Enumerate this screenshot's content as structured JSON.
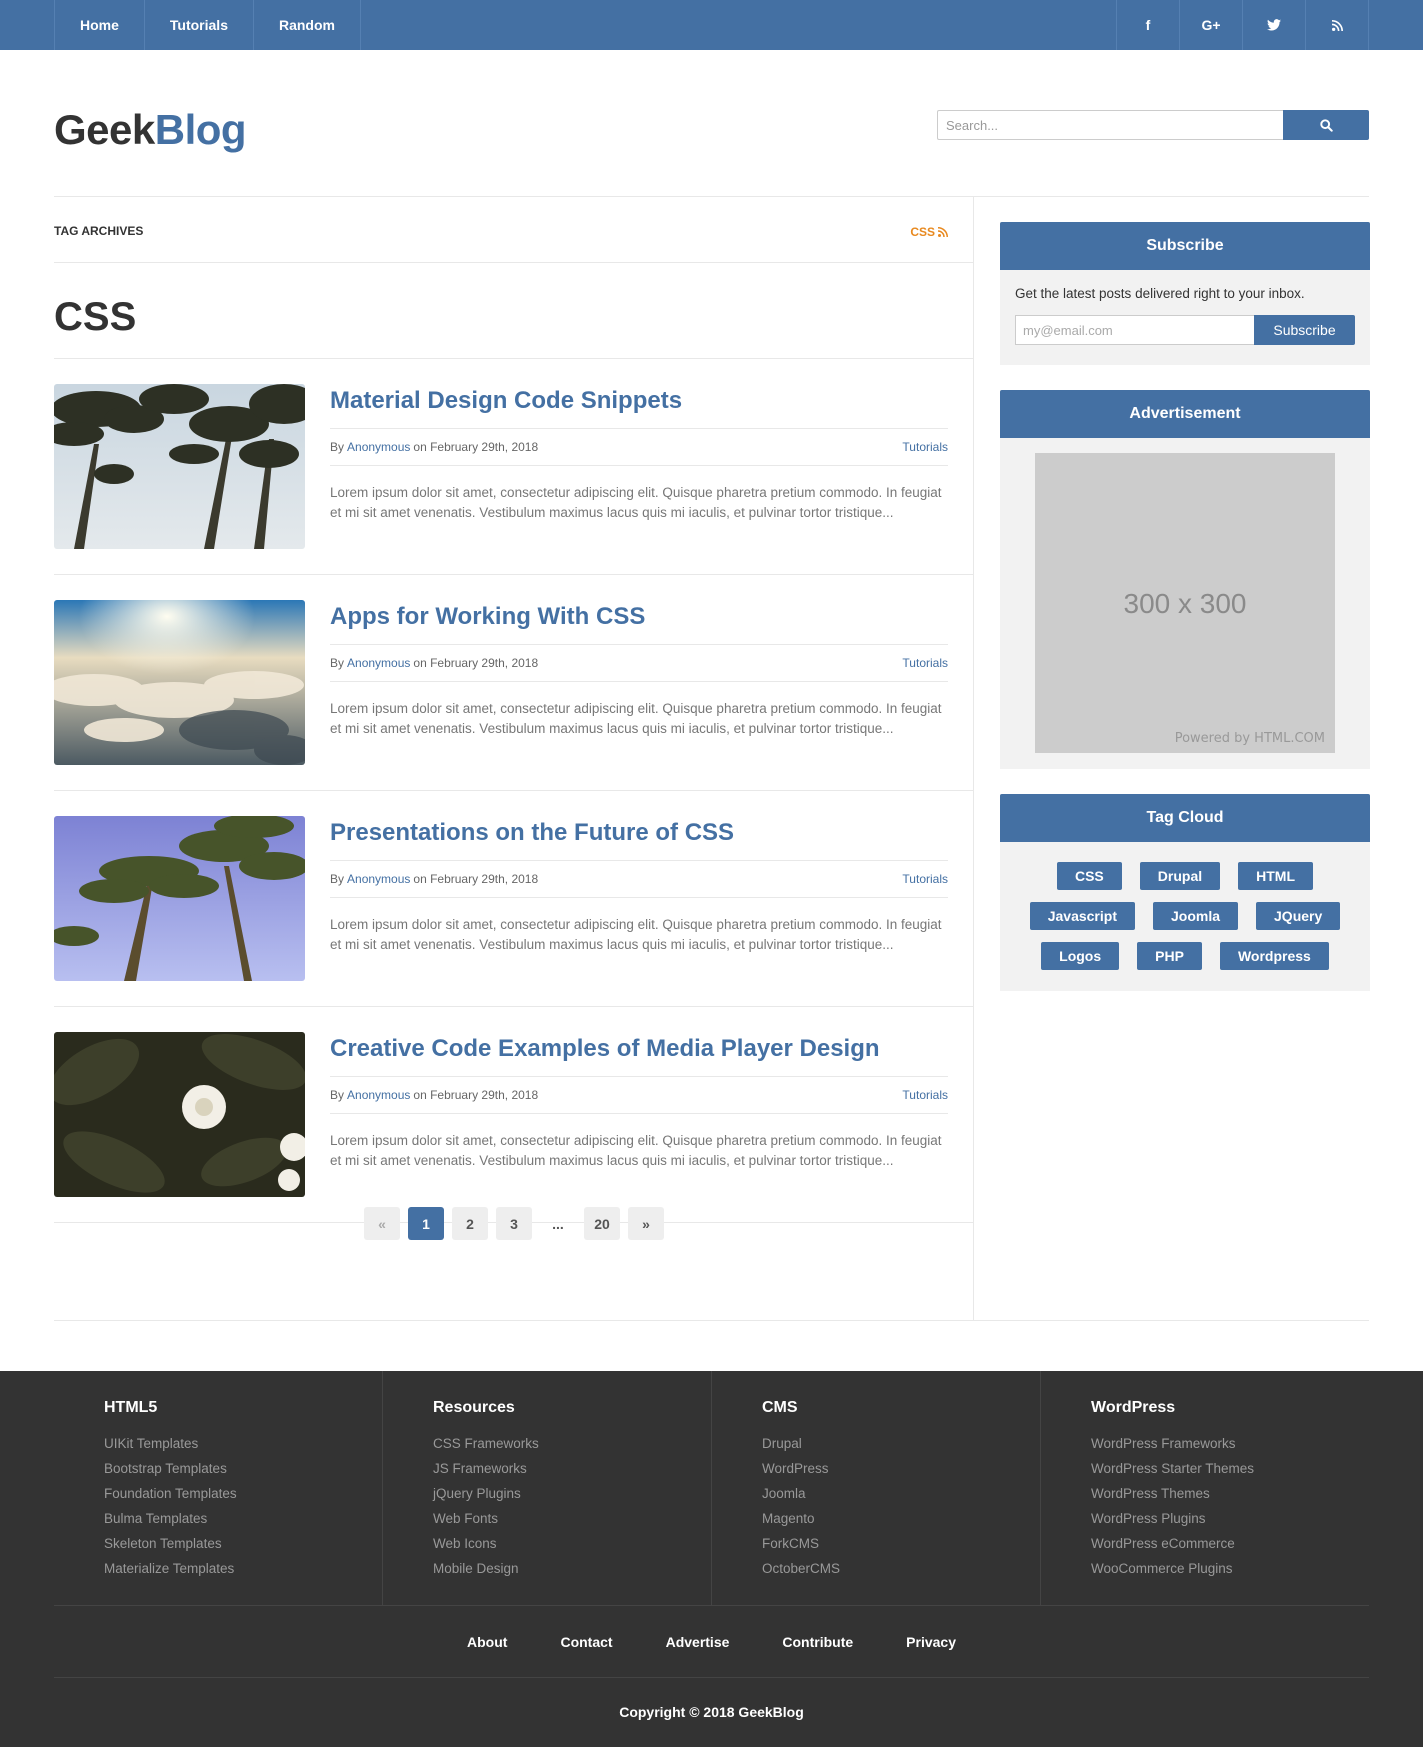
{
  "nav": {
    "items": [
      {
        "label": "Home"
      },
      {
        "label": "Tutorials"
      },
      {
        "label": "Random"
      }
    ],
    "social": [
      {
        "label": "f",
        "icon": "facebook-icon"
      },
      {
        "label": "G+",
        "icon": "google-plus-icon"
      },
      {
        "label": "",
        "icon": "twitter-icon"
      },
      {
        "label": "",
        "icon": "rss-icon"
      }
    ]
  },
  "header": {
    "logo_part1": "Geek",
    "logo_part2": "Blog",
    "search_placeholder": "Search..."
  },
  "archive": {
    "label": "Tag Archives",
    "feed_label": "CSS",
    "tag_title": "CSS"
  },
  "posts": [
    {
      "title": "Material Design Code Snippets",
      "by": "By",
      "author": "Anonymous",
      "date": "on February 29th, 2018",
      "category": "Tutorials",
      "excerpt": "Lorem ipsum dolor sit amet, consectetur adipiscing elit. Quisque pharetra pretium commodo. In feugiat et mi sit amet venenatis. Vestibulum maximus lacus quis mi iaculis, et pulvinar tortor tristique..."
    },
    {
      "title": "Apps for Working With CSS",
      "by": "By",
      "author": "Anonymous",
      "date": "on February 29th, 2018",
      "category": "Tutorials",
      "excerpt": "Lorem ipsum dolor sit amet, consectetur adipiscing elit. Quisque pharetra pretium commodo. In feugiat et mi sit amet venenatis. Vestibulum maximus lacus quis mi iaculis, et pulvinar tortor tristique..."
    },
    {
      "title": "Presentations on the Future of CSS",
      "by": "By",
      "author": "Anonymous",
      "date": "on February 29th, 2018",
      "category": "Tutorials",
      "excerpt": "Lorem ipsum dolor sit amet, consectetur adipiscing elit. Quisque pharetra pretium commodo. In feugiat et mi sit amet venenatis. Vestibulum maximus lacus quis mi iaculis, et pulvinar tortor tristique..."
    },
    {
      "title": "Creative Code Examples of Media Player Design",
      "by": "By",
      "author": "Anonymous",
      "date": "on February 29th, 2018",
      "category": "Tutorials",
      "excerpt": "Lorem ipsum dolor sit amet, consectetur adipiscing elit. Quisque pharetra pretium commodo. In feugiat et mi sit amet venenatis. Vestibulum maximus lacus quis mi iaculis, et pulvinar tortor tristique..."
    }
  ],
  "pagination": {
    "prev": "«",
    "pages": [
      "1",
      "2",
      "3"
    ],
    "ellipsis": "...",
    "last": "20",
    "next": "»"
  },
  "sidebar": {
    "subscribe": {
      "title": "Subscribe",
      "text": "Get the latest posts delivered right to your inbox.",
      "placeholder": "my@email.com",
      "button": "Subscribe"
    },
    "ad": {
      "title": "Advertisement",
      "size": "300 x 300",
      "powered": "Powered by HTML.COM"
    },
    "tags": {
      "title": "Tag Cloud",
      "items": [
        "CSS",
        "Drupal",
        "HTML",
        "Javascript",
        "Joomla",
        "JQuery",
        "Logos",
        "PHP",
        "Wordpress"
      ]
    }
  },
  "footer": {
    "columns": [
      {
        "title": "HTML5",
        "links": [
          "UIKit Templates",
          "Bootstrap Templates",
          "Foundation Templates",
          "Bulma Templates",
          "Skeleton Templates",
          "Materialize Templates"
        ]
      },
      {
        "title": "Resources",
        "links": [
          "CSS Frameworks",
          "JS Frameworks",
          "jQuery Plugins",
          "Web Fonts",
          "Web Icons",
          "Mobile Design"
        ]
      },
      {
        "title": "CMS",
        "links": [
          "Drupal",
          "WordPress",
          "Joomla",
          "Magento",
          "ForkCMS",
          "OctoberCMS"
        ]
      },
      {
        "title": "WordPress",
        "links": [
          "WordPress Frameworks",
          "WordPress Starter Themes",
          "WordPress Themes",
          "WordPress Plugins",
          "WordPress eCommerce",
          "WooCommerce Plugins"
        ]
      }
    ],
    "links": [
      "About",
      "Contact",
      "Advertise",
      "Contribute",
      "Privacy"
    ],
    "copyright": "Copyright © 2018 GeekBlog"
  },
  "colors": {
    "brand": "#4470a3",
    "feed": "#e8891f",
    "footer_bg": "#333333"
  }
}
